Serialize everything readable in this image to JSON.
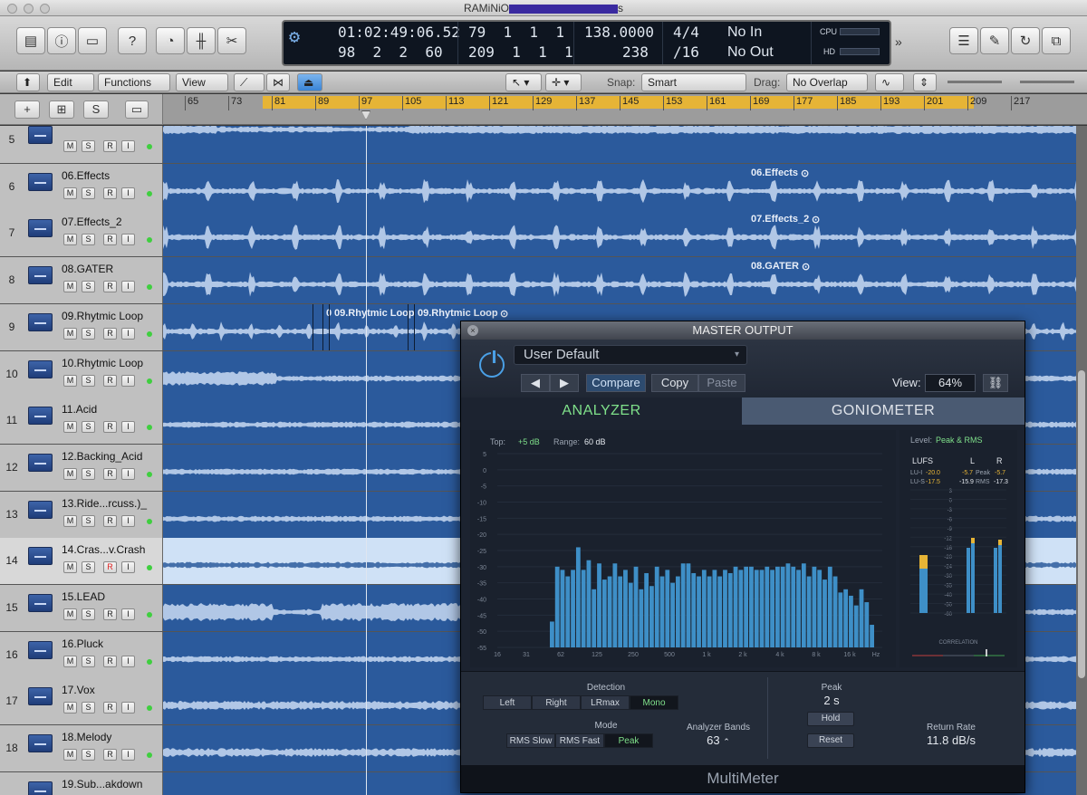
{
  "window": {
    "title_prefix": "RAMiNiO",
    "title_suffix": "s"
  },
  "lcd": {
    "time": "01:02:49:06.52",
    "time_sub": "98  2  2  60",
    "bars": "79  1  1  1",
    "bars_sub": "209  1  1  1",
    "tempo": "138.0000",
    "tempo_sub": "238",
    "sig": "4/4",
    "sig_sub": "/16",
    "in": "No In",
    "out": "No Out",
    "cpu_label": "CPU",
    "hd_label": "HD"
  },
  "toolbar": {
    "edit": "Edit",
    "functions": "Functions",
    "view": "View",
    "snap_label": "Snap:",
    "snap_value": "Smart",
    "drag_label": "Drag:",
    "drag_value": "No Overlap"
  },
  "header": {
    "add": "+",
    "s_button": "S"
  },
  "ruler": [
    "65",
    "73",
    "81",
    "89",
    "97",
    "105",
    "113",
    "121",
    "129",
    "137",
    "145",
    "153",
    "161",
    "169",
    "177",
    "185",
    "193",
    "201",
    "209",
    "217"
  ],
  "tracks": [
    {
      "num": "5",
      "name": "",
      "region": "",
      "color": "#2b5a9c"
    },
    {
      "num": "6",
      "name": "06.Effects",
      "region": "06.Effects"
    },
    {
      "num": "7",
      "name": "07.Effects_2",
      "region": "07.Effects_2"
    },
    {
      "num": "8",
      "name": "08.GATER",
      "region": "08.GATER"
    },
    {
      "num": "9",
      "name": "09.Rhytmic Loop",
      "region": "09.Rhytmic Loop",
      "region2": "09.Rhytmic Loop",
      "region3": "0"
    },
    {
      "num": "10",
      "name": "10.Rhytmic Loop",
      "region": ""
    },
    {
      "num": "11",
      "name": "11.Acid",
      "region": ""
    },
    {
      "num": "12",
      "name": "12.Backing_Acid",
      "region": ""
    },
    {
      "num": "13",
      "name": "13.Ride...rcuss.)_",
      "region": ""
    },
    {
      "num": "14",
      "name": "14.Cras...v.Crash",
      "region": ""
    },
    {
      "num": "15",
      "name": "15.LEAD",
      "region": ""
    },
    {
      "num": "16",
      "name": "16.Pluck",
      "region": ""
    },
    {
      "num": "17",
      "name": "17.Vox",
      "region": ""
    },
    {
      "num": "18",
      "name": "18.Melody",
      "region": ""
    },
    {
      "num": "",
      "name": "19.Sub...akdown",
      "region": ""
    }
  ],
  "track_buttons": {
    "m": "M",
    "s": "S",
    "r": "R",
    "i": "I"
  },
  "plugin": {
    "title": "MASTER OUTPUT",
    "close": "×",
    "preset": "User Default",
    "prev": "◀",
    "next": "▶",
    "compare": "Compare",
    "copy": "Copy",
    "paste": "Paste",
    "view_label": "View:",
    "view_value": "64%",
    "tab_analyzer": "ANALYZER",
    "tab_goniometer": "GONIOMETER",
    "top_label": "Top:",
    "top_value": "+5 dB",
    "range_label": "Range:",
    "range_value": "60 dB",
    "level_label": "Level:",
    "level_value": "Peak & RMS",
    "lufs": "LUFS",
    "l": "L",
    "r": "R",
    "lui": "LU-I",
    "lui_val": "-20.0",
    "lus": "LU-S",
    "lus_val": "-17.5",
    "l_peak": "-5.7",
    "peak_label": "Peak",
    "r_peak": "-5.7",
    "l_rms": "-15.9",
    "rms_label": "RMS",
    "r_rms": "-17.3",
    "correlation": "CORRELATION",
    "detection": "Detection",
    "det_left": "Left",
    "det_right": "Right",
    "det_lrmax": "LRmax",
    "det_mono": "Mono",
    "mode": "Mode",
    "mode_rms_slow": "RMS Slow",
    "mode_rms_fast": "RMS Fast",
    "mode_peak": "Peak",
    "bands_label": "Analyzer Bands",
    "bands_value": "63",
    "peak_hold_label": "Peak",
    "peak_hold_value": "2 s",
    "hold": "Hold",
    "reset": "Reset",
    "return_label": "Return Rate",
    "return_value": "11.8 dB/s",
    "footer": "MultiMeter",
    "y_ticks": [
      "5",
      "0",
      "-5",
      "-10",
      "-15",
      "-20",
      "-25",
      "-30",
      "-35",
      "-40",
      "-45",
      "-50",
      "-55"
    ],
    "x_ticks": [
      "16",
      "31",
      "62",
      "125",
      "250",
      "500",
      "1 k",
      "2 k",
      "4 k",
      "8 k",
      "16 k",
      "Hz"
    ],
    "meter_ticks": [
      "3",
      "0",
      "-3",
      "-6",
      "-9",
      "-12",
      "-16",
      "-20",
      "-24",
      "-30",
      "-35",
      "-40",
      "-50",
      "-60"
    ],
    "spectrum": [
      -47,
      -30,
      -31,
      -33,
      -31,
      -24,
      -31,
      -28,
      -37,
      -29,
      -34,
      -33,
      -29,
      -33,
      -31,
      -35,
      -30,
      -37,
      -32,
      -36,
      -30,
      -33,
      -31,
      -35,
      -33,
      -29,
      -29,
      -32,
      -33,
      -31,
      -33,
      -31,
      -33,
      -31,
      -32,
      -30,
      -31,
      -30,
      -30,
      -31,
      -31,
      -30,
      -31,
      -30,
      -30,
      -29,
      -30,
      -31,
      -29,
      -33,
      -30,
      -31,
      -34,
      -30,
      -33,
      -38,
      -37,
      -39,
      -42,
      -37,
      -41,
      -48
    ]
  },
  "colors": {
    "lane": "#2b5a9c",
    "wave": "#c9daf3",
    "accent": "#7fe08a",
    "cycle": "#e6b436"
  }
}
